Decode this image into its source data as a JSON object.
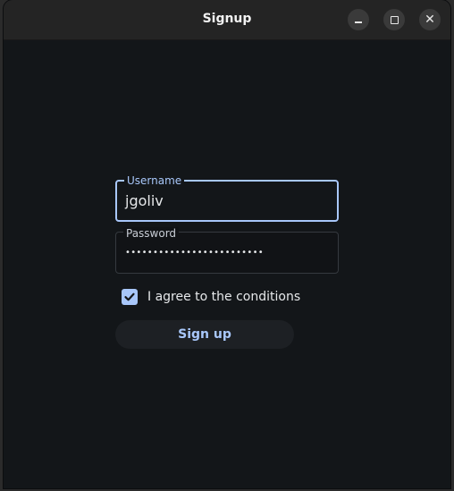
{
  "window": {
    "title": "Signup"
  },
  "form": {
    "username": {
      "label": "Username",
      "value": "jgoliv"
    },
    "password": {
      "label": "Password",
      "masked_value": "•••••••••••••••••••••••••"
    },
    "agree": {
      "label": "I agree to the conditions",
      "checked": true
    },
    "submit_label": "Sign up"
  },
  "colors": {
    "accent": "#a8c7fa",
    "window_bg": "#131619",
    "titlebar_bg": "#242424"
  }
}
